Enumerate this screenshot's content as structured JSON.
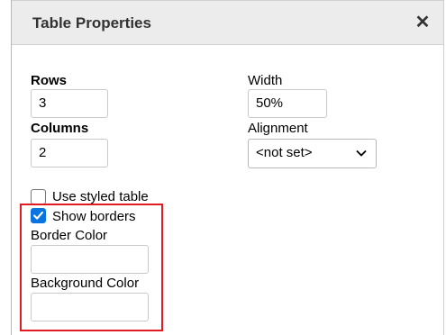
{
  "dialog": {
    "title": "Table Properties",
    "close_icon": "close-icon"
  },
  "rows": {
    "label": "Rows",
    "value": "3"
  },
  "columns": {
    "label": "Columns",
    "value": "2"
  },
  "width": {
    "label": "Width",
    "value": "50%"
  },
  "alignment": {
    "label": "Alignment",
    "selected": "<not set>"
  },
  "options": {
    "use_styled_table": {
      "label": "Use styled table",
      "checked": false
    },
    "show_borders": {
      "label": "Show borders",
      "checked": true
    }
  },
  "border_color": {
    "label": "Border Color",
    "value": ""
  },
  "background_color": {
    "label": "Background Color",
    "value": ""
  },
  "colors": {
    "highlight_box": "#e01b22",
    "checkbox_accent": "#0a75e0",
    "titlebar_bg": "#ececec"
  }
}
